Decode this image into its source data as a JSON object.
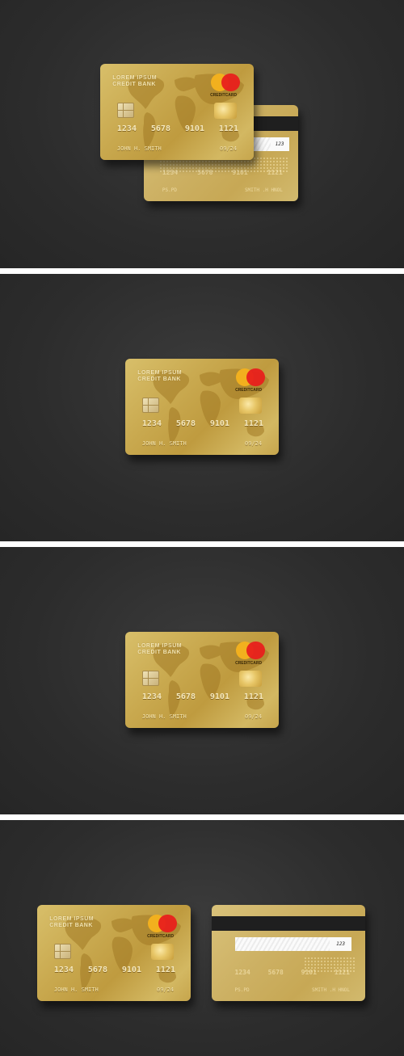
{
  "colors": {
    "background": "#2e2e2e",
    "gold": "#c9a94f",
    "brand_red": "#e8201c",
    "brand_yellow": "#f2b01e",
    "stripe": "#1f1f1f"
  },
  "front": {
    "bank_line1": "LOREM IPSUM",
    "bank_line2": "CREDIT BANK",
    "brand": "CREDITCARD",
    "number_groups": [
      "1234",
      "5678",
      "9101",
      "1121"
    ],
    "holder": "JOHN H. SMITH",
    "expiry": "09/24",
    "icons": {
      "chip": "emv-chip-icon",
      "logo": "card-network-logo-icon",
      "hologram": "hologram-icon",
      "map": "world-map"
    }
  },
  "back": {
    "cvv": "123",
    "number_groups": [
      "1234",
      "5678",
      "9101",
      "1121"
    ],
    "holder": "PS.PD",
    "name": "SMITH .H HNOL"
  }
}
